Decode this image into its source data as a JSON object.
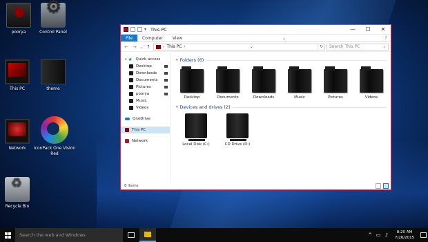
{
  "desktop": {
    "icons": [
      {
        "label": "poorya"
      },
      {
        "label": "Control Panel"
      },
      {
        "label": "This PC"
      },
      {
        "label": "theme"
      },
      {
        "label": "Network"
      },
      {
        "label": "IconPack One Vision Red"
      },
      {
        "label": "Recycle Bin"
      }
    ]
  },
  "window": {
    "title": "This PC",
    "controls": {
      "minimize": "—",
      "maximize": "☐",
      "close": "✕",
      "help": "?"
    },
    "ribbon": {
      "tabs": [
        "File",
        "Computer",
        "View"
      ],
      "active": "File",
      "expand": "⌄"
    },
    "address": {
      "path": "This PC",
      "separator": "›",
      "dropdown": "⌄",
      "refresh": "↻",
      "back": "←",
      "forward": "→",
      "up": "↑",
      "recent": "⌄"
    },
    "search": {
      "placeholder": "Search This PC",
      "icon": "search-icon"
    },
    "sidebar": {
      "quick_access": "Quick access",
      "pinned": [
        "Desktop",
        "Downloads",
        "Documents",
        "Pictures",
        "poorya",
        "Music",
        "Videos"
      ],
      "onedrive": "OneDrive",
      "this_pc": "This PC",
      "network": "Network"
    },
    "groups": {
      "folders": {
        "label": "Folders (6)",
        "items": [
          "Desktop",
          "Documents",
          "Downloads",
          "Music",
          "Pictures",
          "Videos"
        ]
      },
      "drives": {
        "label": "Devices and drives (2)",
        "items": [
          "Local Disk (C:)",
          "CD Drive (D:)"
        ]
      }
    },
    "status": "8 items"
  },
  "taskbar": {
    "search_placeholder": "Search the web and Windows",
    "time": "8:20 AM",
    "date": "7/26/2015",
    "tray_chevron": "^"
  }
}
